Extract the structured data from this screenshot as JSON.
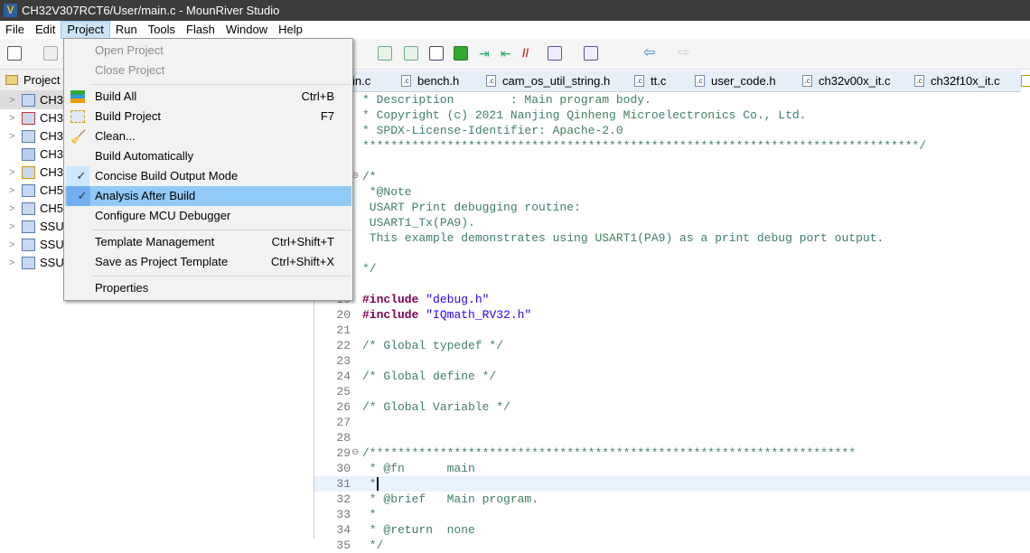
{
  "window": {
    "title": "CH32V307RCT6/User/main.c - MounRiver Studio"
  },
  "menubar": [
    "File",
    "Edit",
    "Project",
    "Run",
    "Tools",
    "Flash",
    "Window",
    "Help"
  ],
  "project_panel": {
    "title": "Project",
    "items": [
      {
        "label": "CH3",
        "icon": "project-icon"
      },
      {
        "label": "CH3",
        "icon": "project-error-icon"
      },
      {
        "label": "CH3",
        "icon": "project-icon"
      },
      {
        "label": "CH3",
        "icon": "folder-icon"
      },
      {
        "label": "CH3",
        "icon": "project-warning-icon"
      },
      {
        "label": "CH5",
        "icon": "project-icon"
      },
      {
        "label": "CH5",
        "icon": "project-icon"
      },
      {
        "label": "SSU",
        "icon": "project-icon"
      },
      {
        "label": "SSU",
        "icon": "project-icon"
      },
      {
        "label": "SSU",
        "icon": "project-icon"
      }
    ]
  },
  "tabs": [
    "in.c",
    "bench.h",
    "cam_os_util_string.h",
    "tt.c",
    "user_code.h",
    "ch32v00x_it.c",
    "ch32f10x_it.c"
  ],
  "project_menu": {
    "open_project": "Open Project",
    "close_project": "Close Project",
    "build_all": "Build All",
    "build_all_sc": "Ctrl+B",
    "build_project": "Build Project",
    "build_project_sc": "F7",
    "clean": "Clean...",
    "build_auto": "Build Automatically",
    "concise": "Concise Build Output Mode",
    "analysis": "Analysis After Build",
    "configure": "Configure MCU Debugger",
    "template_mgmt": "Template Management",
    "template_mgmt_sc": "Ctrl+Shift+T",
    "save_template": "Save as Project Template",
    "save_template_sc": "Ctrl+Shift+X",
    "properties": "Properties"
  },
  "code": [
    {
      "n": "6",
      "t": "c",
      "text": "* Description        : Main program body."
    },
    {
      "n": "7",
      "t": "c",
      "text": "* Copyright (c) 2021 Nanjing Qinheng Microelectronics Co., Ltd."
    },
    {
      "n": "8",
      "t": "c",
      "text": "* SPDX-License-Identifier: Apache-2.0"
    },
    {
      "n": "9",
      "t": "c",
      "text": "*******************************************************************************/"
    },
    {
      "n": "10",
      "t": "c",
      "text": ""
    },
    {
      "n": "11",
      "t": "c",
      "text": "/*"
    },
    {
      "n": "12",
      "t": "c",
      "text": " *@Note"
    },
    {
      "n": "13",
      "t": "c",
      "text": " USART Print debugging routine:"
    },
    {
      "n": "14",
      "t": "c",
      "text": " USART1_Tx(PA9)."
    },
    {
      "n": "15",
      "t": "c",
      "text": " This example demonstrates using USART1(PA9) as a print debug port output."
    },
    {
      "n": "16",
      "t": "c",
      "text": ""
    },
    {
      "n": "17",
      "t": "c",
      "text": "*/"
    },
    {
      "n": "18",
      "t": "c",
      "text": ""
    },
    {
      "n": "19",
      "t": "inc",
      "kw": "#include",
      "str": "\"debug.h\""
    },
    {
      "n": "20",
      "t": "inc",
      "kw": "#include",
      "str": "\"IQmath_RV32.h\""
    },
    {
      "n": "21",
      "t": "c",
      "text": ""
    },
    {
      "n": "22",
      "t": "c",
      "text": "/* Global typedef */"
    },
    {
      "n": "23",
      "t": "c",
      "text": ""
    },
    {
      "n": "24",
      "t": "c",
      "text": "/* Global define */"
    },
    {
      "n": "25",
      "t": "c",
      "text": ""
    },
    {
      "n": "26",
      "t": "c",
      "text": "/* Global Variable */"
    },
    {
      "n": "27",
      "t": "c",
      "text": ""
    },
    {
      "n": "28",
      "t": "c",
      "text": ""
    },
    {
      "n": "29",
      "t": "c",
      "text": "/*********************************************************************"
    },
    {
      "n": "30",
      "t": "c",
      "text": " * @fn      main"
    },
    {
      "n": "31",
      "t": "c",
      "text": " *"
    },
    {
      "n": "32",
      "t": "c",
      "text": " * @brief   Main program."
    },
    {
      "n": "33",
      "t": "c",
      "text": " *"
    },
    {
      "n": "34",
      "t": "c",
      "text": " * @return  none"
    },
    {
      "n": "35",
      "t": "c",
      "text": " */"
    }
  ],
  "current_line": "31"
}
